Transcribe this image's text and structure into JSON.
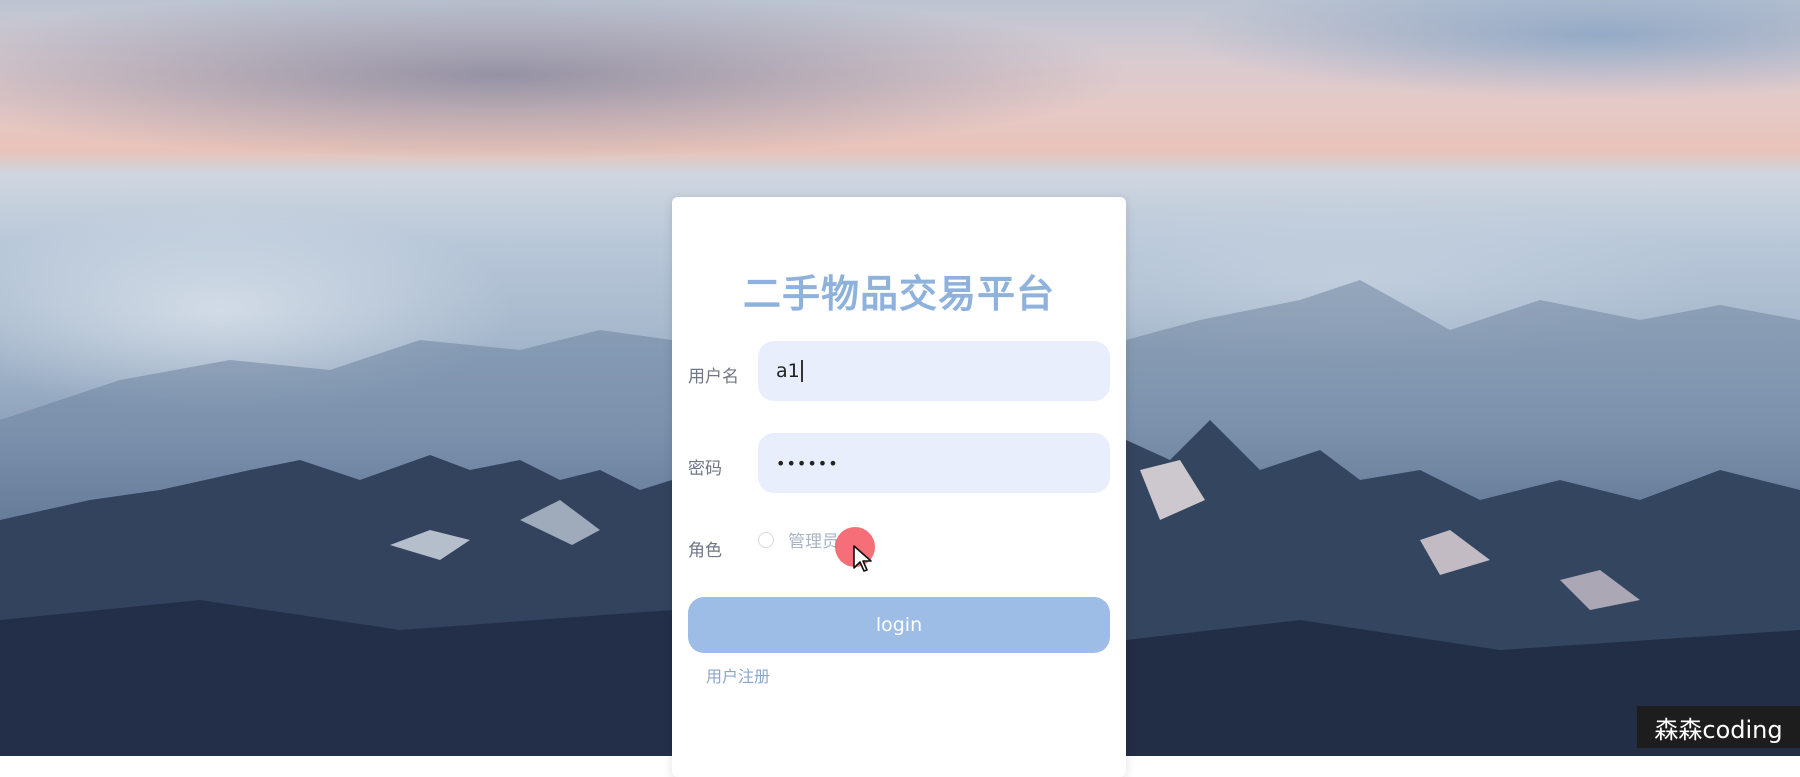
{
  "app": {
    "title": "二手物品交易平台"
  },
  "form": {
    "username": {
      "label": "用户名",
      "value": "a1"
    },
    "password": {
      "label": "密码",
      "value": "••••••"
    },
    "role": {
      "label": "角色",
      "options": [
        {
          "label": "管理员",
          "selected": false
        }
      ]
    },
    "login_label": "login",
    "register_label": "用户注册"
  },
  "overlay": {
    "watermark": "森森coding"
  },
  "colors": {
    "title": "#8fb2dd",
    "field_bg": "#e8eefc",
    "button_bg": "#9dbde6",
    "link": "#8aa7cc"
  },
  "icons": {
    "cursor": "mouse-pointer-icon"
  }
}
